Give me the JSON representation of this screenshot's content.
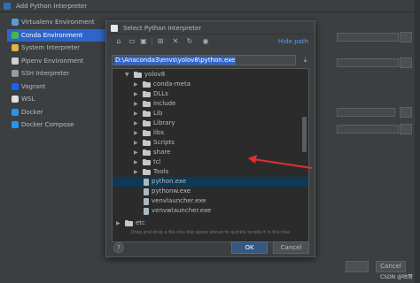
{
  "outer": {
    "title": "Add Python Interpreter",
    "sidebar": [
      {
        "label": "Virtualenv Environment",
        "icon": "virtualenv-icon",
        "color": "#5b9bd5"
      },
      {
        "label": "Conda Environment",
        "icon": "conda-icon",
        "color": "#44b74a",
        "selected": true
      },
      {
        "label": "System Interpreter",
        "icon": "python-icon",
        "color": "#e0b34d"
      },
      {
        "label": "Pipenv Environment",
        "icon": "pipenv-icon",
        "color": "#d0d0d0"
      },
      {
        "label": "SSH Interpreter",
        "icon": "terminal-icon",
        "color": "#9a9a9a"
      },
      {
        "label": "Vagrant",
        "icon": "vagrant-icon",
        "color": "#1563ff"
      },
      {
        "label": "WSL",
        "icon": "linux-icon",
        "color": "#e0e0e0"
      },
      {
        "label": "Docker",
        "icon": "docker-icon",
        "color": "#2496ed"
      },
      {
        "label": "Docker Compose",
        "icon": "docker-compose-icon",
        "color": "#2496ed"
      }
    ],
    "ok_label": "OK",
    "cancel_label": "Cancel",
    "watermark": "CSDN @咕哥"
  },
  "dialog": {
    "title": "Select Python Interpreter",
    "hide_path_label": "Hide path",
    "path_value": "D:\\Anaconda3\\envs\\yolov8\\python.exe",
    "tree": [
      {
        "label": "yolov8",
        "type": "folder",
        "expanded": true,
        "level": 0
      },
      {
        "label": "conda-meta",
        "type": "folder",
        "level": 1
      },
      {
        "label": "DLLs",
        "type": "folder",
        "level": 1
      },
      {
        "label": "include",
        "type": "folder",
        "level": 1
      },
      {
        "label": "Lib",
        "type": "folder",
        "level": 1
      },
      {
        "label": "Library",
        "type": "folder",
        "level": 1
      },
      {
        "label": "libs",
        "type": "folder",
        "level": 1
      },
      {
        "label": "Scripts",
        "type": "folder",
        "level": 1
      },
      {
        "label": "share",
        "type": "folder",
        "level": 1
      },
      {
        "label": "tcl",
        "type": "folder",
        "level": 1
      },
      {
        "label": "Tools",
        "type": "folder",
        "level": 1
      },
      {
        "label": "python.exe",
        "type": "file",
        "level": 1,
        "selected": true
      },
      {
        "label": "pythonw.exe",
        "type": "file",
        "level": 1
      },
      {
        "label": "venvlauncher.exe",
        "type": "file",
        "level": 1
      },
      {
        "label": "venvwlauncher.exe",
        "type": "file",
        "level": 1
      },
      {
        "label": "etc",
        "type": "folder",
        "level": -1
      }
    ],
    "hint": "Drag and drop a file into the space above to quickly locate it in the tree",
    "help_label": "?",
    "ok_label": "OK",
    "cancel_label": "Cancel",
    "accent": "#2f65ca",
    "annotation_color": "#e0302e"
  }
}
